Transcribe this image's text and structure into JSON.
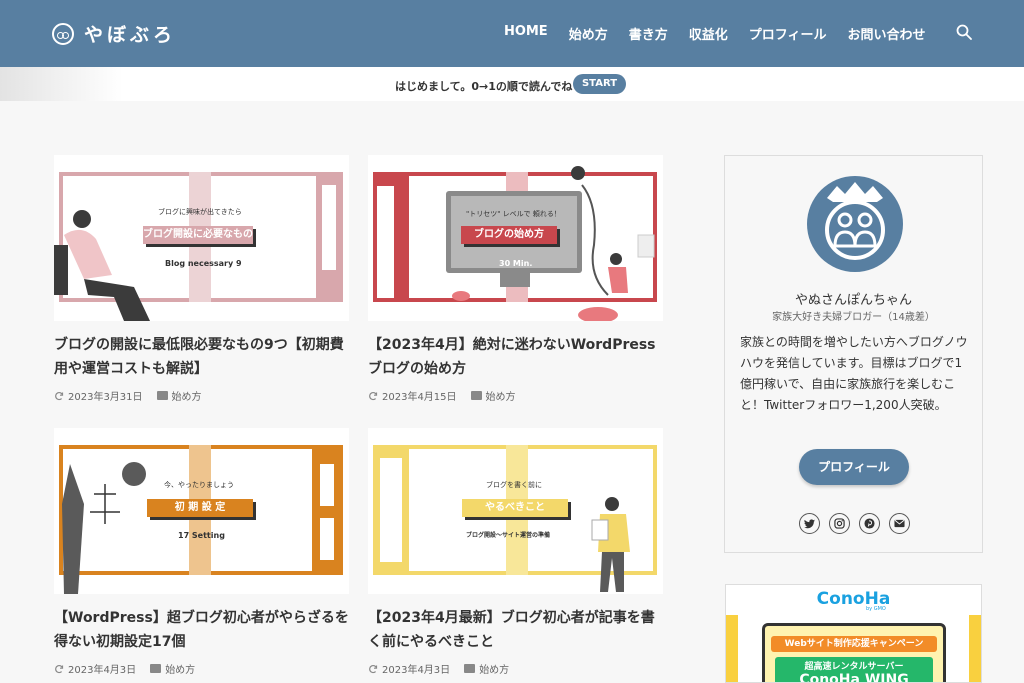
{
  "header": {
    "logo_text": "やぼぶろ",
    "nav": [
      "HOME",
      "始め方",
      "書き方",
      "収益化",
      "プロフィール",
      "お問い合わせ"
    ]
  },
  "infobar": {
    "text": "はじめまして。0→1の順で読んでね",
    "button": "START"
  },
  "posts": [
    {
      "title": "ブログの開設に最低限必要なもの9つ【初期費用や運営コストも解説】",
      "date": "2023年3月31日",
      "category": "始め方",
      "thumb": {
        "small": "ブログに興味が出てきたら",
        "tag": "ブログ開設に必要なもの",
        "foot": "Blog necessary 9"
      }
    },
    {
      "title": "【2023年4月】絶対に迷わないWordPressブログの始め方",
      "date": "2023年4月15日",
      "category": "始め方",
      "thumb": {
        "small": "\"トリセツ\" レベルで 頼れる！",
        "tag": "ブログの始め方",
        "foot": "30 Min."
      }
    },
    {
      "title": "【WordPress】超ブログ初心者がやらざるを得ない初期設定17個",
      "date": "2023年4月3日",
      "category": "始め方",
      "thumb": {
        "small": "今、やったりましょう",
        "tag": "初 期 設 定",
        "foot": "17 Setting"
      }
    },
    {
      "title": "【2023年4月最新】ブログ初心者が記事を書く前にやるべきこと",
      "date": "2023年4月3日",
      "category": "始め方",
      "thumb": {
        "small": "ブログを書く前に",
        "tag": "やるべきこと",
        "foot": "ブログ開設～サイト運営の準備"
      }
    }
  ],
  "profile": {
    "name": "やぬさんぽんちゃん",
    "subtitle": "家族大好き夫婦ブロガー（14歳差）",
    "description": "家族との時間を増やしたい方へブログノウハウを発信しています。目標はブログで1億円稼いで、自由に家族旅行を楽しむこと！Twitterフォロワー1,200人突破。",
    "button": "プロフィール",
    "social_icons": [
      "twitter-icon",
      "instagram-icon",
      "pinterest-icon",
      "mail-icon"
    ]
  },
  "banner": {
    "brand": "ConoHa",
    "brand_sub": "by GMO",
    "campaign": "Webサイト制作応援キャンペーン",
    "line1": "超高速レンタルサーバー",
    "line2": "ConoHa WING"
  },
  "colors": {
    "header": "#587fa1",
    "card1": "#d8a7ac",
    "card2": "#c8474d",
    "card3": "#d9831f",
    "card4": "#f3d86a"
  }
}
